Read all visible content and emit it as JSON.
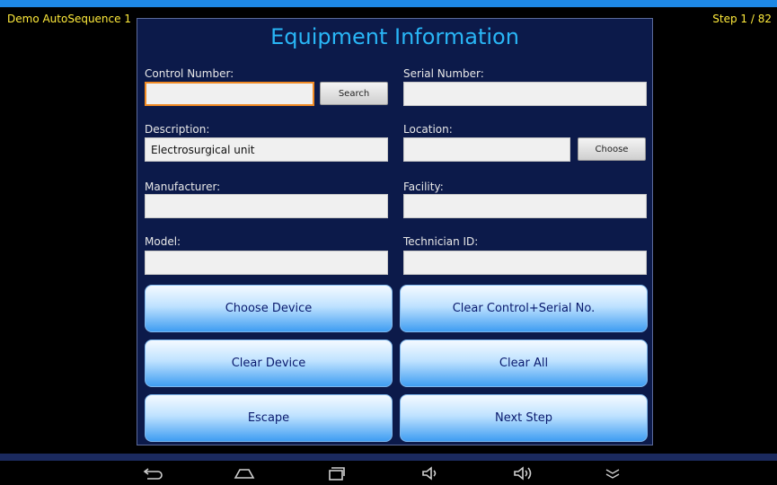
{
  "status": {
    "app_name": "Demo AutoSequence 1",
    "step": "Step 1 / 82"
  },
  "form": {
    "title": "Equipment Information",
    "control_number": {
      "label": "Control Number:",
      "value": ""
    },
    "search_label": "Search",
    "serial_number": {
      "label": "Serial Number:",
      "value": ""
    },
    "description": {
      "label": "Description:",
      "value": "Electrosurgical unit"
    },
    "location": {
      "label": "Location:",
      "value": ""
    },
    "choose_label": "Choose",
    "manufacturer": {
      "label": "Manufacturer:",
      "value": ""
    },
    "facility": {
      "label": "Facility:",
      "value": ""
    },
    "model": {
      "label": "Model:",
      "value": ""
    },
    "technician_id": {
      "label": "Technician ID:",
      "value": ""
    }
  },
  "actions": {
    "choose_device": "Choose Device",
    "clear_control_serial": "Clear Control+Serial No.",
    "clear_device": "Clear Device",
    "clear_all": "Clear All",
    "escape": "Escape",
    "next_step": "Next Step"
  },
  "navbar": {
    "icons": [
      "back-icon",
      "home-icon",
      "recent-apps-icon",
      "volume-down-icon",
      "volume-up-icon",
      "hide-keyboard-icon"
    ]
  },
  "colors": {
    "title": "#29b6f6",
    "status_text": "#ffeb3b",
    "panel_bg": "#0c1a4a",
    "active_field_border": "#f08a24"
  }
}
